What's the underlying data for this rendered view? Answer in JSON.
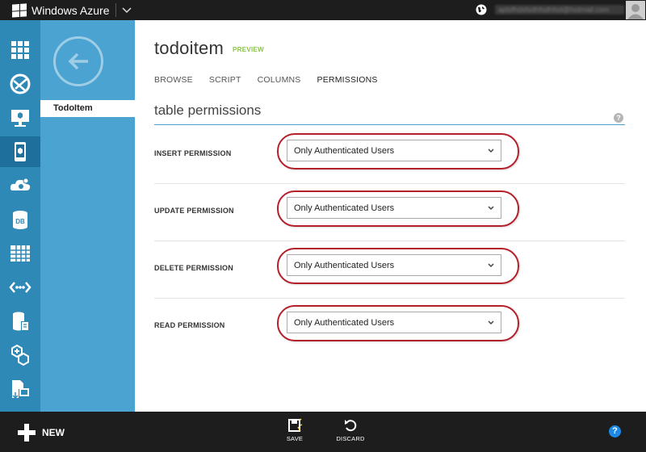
{
  "topbar": {
    "brand": "Windows Azure",
    "account_email": "ajdsfhdsfsdhfsdhfsd@hotmail.com"
  },
  "sidebar": {
    "items": [
      {
        "name": "all-items-icon"
      },
      {
        "name": "websites-icon"
      },
      {
        "name": "virtual-machines-icon"
      },
      {
        "name": "mobile-services-icon",
        "active": true
      },
      {
        "name": "cloud-services-icon"
      },
      {
        "name": "sql-databases-icon"
      },
      {
        "name": "storage-icon"
      },
      {
        "name": "service-bus-icon"
      },
      {
        "name": "media-services-icon"
      },
      {
        "name": "hdinsight-icon"
      },
      {
        "name": "import-export-icon"
      }
    ]
  },
  "panel2": {
    "item": "TodoItem"
  },
  "main": {
    "title": "todoitem",
    "badge": "PREVIEW",
    "tabs": [
      "BROWSE",
      "SCRIPT",
      "COLUMNS",
      "PERMISSIONS"
    ],
    "active_tab": "PERMISSIONS",
    "section_title": "table permissions",
    "help": "?",
    "permissions": [
      {
        "label": "INSERT PERMISSION",
        "value": "Only Authenticated Users"
      },
      {
        "label": "UPDATE PERMISSION",
        "value": "Only Authenticated Users"
      },
      {
        "label": "DELETE PERMISSION",
        "value": "Only Authenticated Users"
      },
      {
        "label": "READ PERMISSION",
        "value": "Only Authenticated Users"
      }
    ]
  },
  "bottombar": {
    "new_label": "NEW",
    "save_label": "SAVE",
    "discard_label": "DISCARD",
    "help": "?"
  },
  "colors": {
    "accent": "#2f89b7",
    "panel": "#4aa3d1",
    "highlight_ring": "#b3202a",
    "preview": "#8bc34a"
  }
}
